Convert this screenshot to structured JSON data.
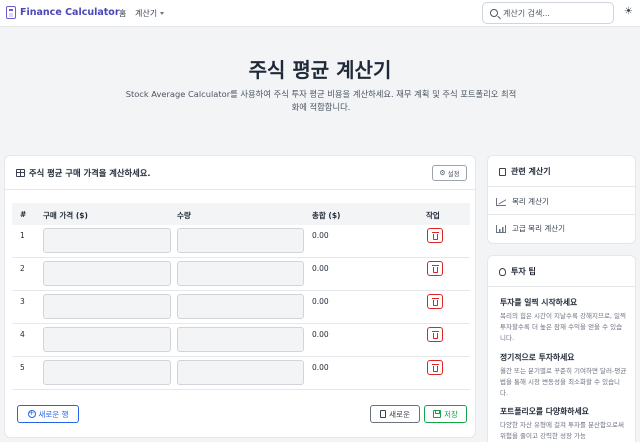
{
  "nav": {
    "brand": "Finance Calculator",
    "home": "홈",
    "calculators": "계산기",
    "search_placeholder": "계산기 검색...",
    "theme_icon": "sun-icon"
  },
  "hero": {
    "title": "주식 평균 계산기",
    "description": "Stock Average Calculator를 사용하여 주식 투자 평균 비용을 계산하세요. 재무 계획 및 주식 포트폴리오 최적화에 적합합니다."
  },
  "calculator": {
    "title": "주식 평균 구매 가격을 계산하세요.",
    "settings_label": "설정",
    "columns": [
      "#",
      "구매 가격 ($)",
      "수량",
      "총합 ($)",
      "작업"
    ],
    "rows": [
      {
        "num": "1",
        "price": "",
        "qty": "",
        "total": "0.00"
      },
      {
        "num": "2",
        "price": "",
        "qty": "",
        "total": "0.00"
      },
      {
        "num": "3",
        "price": "",
        "qty": "",
        "total": "0.00"
      },
      {
        "num": "4",
        "price": "",
        "qty": "",
        "total": "0.00"
      },
      {
        "num": "5",
        "price": "",
        "qty": "",
        "total": "0.00"
      }
    ],
    "add_row_label": "새로운 행",
    "new_label": "새로운",
    "save_label": "저장"
  },
  "related": {
    "title": "관련 계산기",
    "links": [
      "복리 계산기",
      "고급 복리 계산기"
    ]
  },
  "tips": {
    "title": "투자 팁",
    "items": [
      {
        "title": "투자를 일찍 시작하세요",
        "body": "복리의 힘은 시간이 지날수록 강해지므로, 일찍 투자할수록 더 높은 잠재 수익을 얻을 수 있습니다."
      },
      {
        "title": "정기적으로 투자하세요",
        "body": "월간 또는 분기별로 꾸준히 기여하면 달러-평균법을 통해 시장 변동성을 최소화할 수 있습니다."
      },
      {
        "title": "포트폴리오를 다양화하세요",
        "body": "다양한 자산 유형에 걸쳐 투자를 분산함으로써 위험을 줄이고 강력한 성장 가능"
      }
    ]
  },
  "colors": {
    "brand": "#4b47b8",
    "primary": "#2563eb",
    "danger": "#dc2626",
    "success": "#16a34a"
  }
}
